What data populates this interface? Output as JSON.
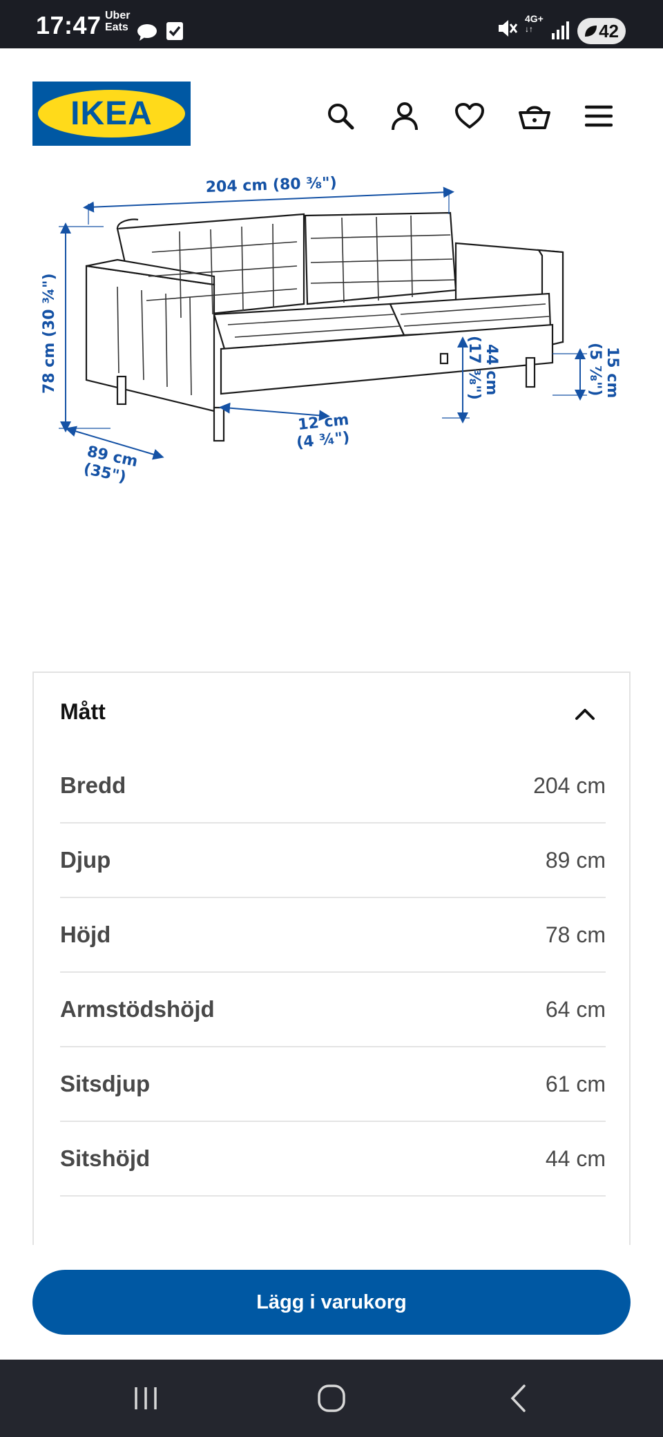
{
  "status_bar": {
    "time": "17:47",
    "uber_line1": "Uber",
    "uber_line2": "Eats",
    "network_line1": "4G+",
    "network_line2": "↓↑",
    "battery": "42"
  },
  "header": {
    "logo_text": "IKEA",
    "icons": [
      "search-icon",
      "profile-icon",
      "heart-icon",
      "cart-icon",
      "menu-icon"
    ]
  },
  "diagram": {
    "width_label": "204 cm (80 ³⁄₈\")",
    "height_label": "78 cm (30 ¾\")",
    "depth_label_cm": "89 cm",
    "depth_label_in": "(35\")",
    "gap_label_cm": "12 cm",
    "gap_label_in": "(4 ¾\")",
    "seat_height_cm": "44 cm",
    "seat_height_in": "(17 ³⁄₈\")",
    "leg_height_cm": "15 cm",
    "leg_height_in": "(5 ⁷⁄₈\")"
  },
  "measurements": {
    "title": "Mått",
    "rows": [
      {
        "label": "Bredd",
        "value": "204 cm"
      },
      {
        "label": "Djup",
        "value": "89 cm"
      },
      {
        "label": "Höjd",
        "value": "78 cm"
      },
      {
        "label": "Armstödshöjd",
        "value": "64 cm"
      },
      {
        "label": "Sitsdjup",
        "value": "61 cm"
      },
      {
        "label": "Sitshöjd",
        "value": "44 cm"
      }
    ]
  },
  "cta": {
    "label": "Lägg i varukorg"
  },
  "colors": {
    "ikea_blue": "#0058a3",
    "ikea_yellow": "#ffda1a",
    "dimension_blue": "#1552a5"
  }
}
